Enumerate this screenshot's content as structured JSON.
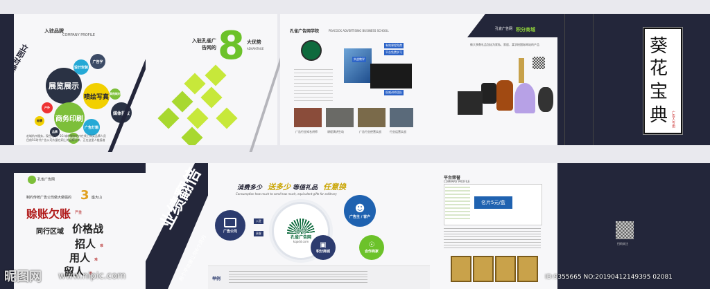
{
  "top": {
    "p1": {
      "header": "入驻品牌",
      "sub": "COMPANY PROFILE",
      "vertical": "立即对接海量客户",
      "bubbles": [
        "展览展示",
        "商务印刷",
        "喷绘写真",
        "设计安装",
        "广告字",
        "媒体投放",
        "户外",
        "广告灯箱",
        "图文快印",
        "标牌",
        "品牌",
        "其他耗材"
      ],
      "foot1": "宏城杭州服务，现在电子、5G 城市服务杭州在线上购买品牌人员",
      "foot2": "目前5G时代广告公司大量在网上的品牌订单、正在这里人链接者"
    },
    "p2": {
      "title": "入驻孔雀广告网的",
      "num": "8",
      "suffix": "大优势",
      "sub": "ADVANTAGE"
    },
    "p3": {
      "brand": "孔雀广告网学院",
      "sub": "PEACOCK ADVERTISING BUSINESS SCHOOL",
      "tags": [
        "有效课程免费",
        "平台免费学习",
        "实战教学",
        "权威讲师团队"
      ],
      "caps": [
        "广告行业知名讲师",
        "课程演讲生动",
        "广告行业经营实战",
        "行业运营实战"
      ]
    },
    "p4": {
      "brand": "孔雀广告网",
      "mall": "积分商城",
      "desc": "做大多数礼品包括为家私、家居、某学校国际网站的产品"
    },
    "cover": {
      "title": [
        "葵",
        "花",
        "宝",
        "典"
      ],
      "stamp": "广告人专用"
    }
  },
  "bottom": {
    "p1": {
      "brand": "孔雀广告网",
      "line": "制约传统广告公司做大做强的",
      "num": "3",
      "suffix": "座大山",
      "l1": "赊账欠账",
      "l1s": "严重",
      "l2a": "同行区域",
      "l2b": "价格战",
      "l3": "招人",
      "l3s": "难",
      "l4": "用人",
      "l4s": "难",
      "l5": "留人",
      "l5s": "难"
    },
    "p2": {
      "big": "业绩翻倍",
      "small": "用个平台做让你6个月内"
    },
    "p3": {
      "h1a": "消费多少",
      "h1b": "送多少",
      "h1c": "等值礼品",
      "h1d": "任意换",
      "sub": "Consumption how much to send how much, equivalent gifts for arbitrary",
      "center": "孔雀广告网",
      "url": "kqadd.com",
      "left": "广告公司",
      "n1": "广告主 / 客户",
      "n2": "积分商城",
      "n3": "合作商家",
      "arrow1": "入驻",
      "arrow2": "获客",
      "bottom_label": "举例"
    },
    "p4": {
      "brand": "孔雀广告网",
      "sub": "平台荣誉",
      "sub2": "COMPANY PROFILE",
      "banner": "名片5元/盒"
    },
    "cover": {
      "qr_caption": "扫码关注"
    }
  },
  "watermark": {
    "logo": "昵图网",
    "url": "www.nipic.com",
    "id": "ID:9355665 NO:20190412149395 02081"
  }
}
